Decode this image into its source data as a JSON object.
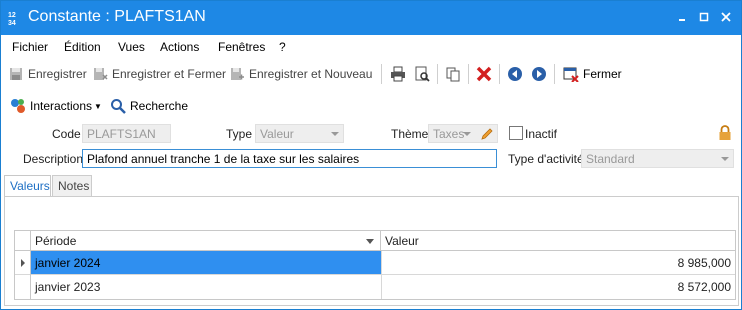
{
  "window": {
    "title": "Constante : PLAFTS1AN",
    "app_icon_text": "1 2\n3 4"
  },
  "menu": [
    "Fichier",
    "Édition",
    "Vues",
    "Actions",
    "Fenêtres",
    "?"
  ],
  "toolbar": {
    "save_label": "Enregistrer",
    "save_close_label": "Enregistrer et Fermer",
    "save_new_label": "Enregistrer et Nouveau",
    "close_label": "Fermer"
  },
  "toolbar2": {
    "interactions_label": "Interactions",
    "search_label": "Recherche"
  },
  "form": {
    "code_label": "Code",
    "code_value": "PLAFTS1AN",
    "type_label": "Type",
    "type_value": "Valeur",
    "theme_label": "Thème",
    "theme_value": "Taxes",
    "inactive_label": "Inactif",
    "description_label": "Description",
    "description_value": "Plafond annuel tranche 1 de la taxe sur les salaires",
    "activity_label": "Type d'activité",
    "activity_value": "Standard"
  },
  "tabs": [
    "Valeurs",
    "Notes"
  ],
  "grid": {
    "columns": [
      "Période",
      "Valeur"
    ],
    "rows": [
      {
        "period": "janvier 2024",
        "value": "8 985,000"
      },
      {
        "period": "janvier 2023",
        "value": "8 572,000"
      }
    ]
  },
  "colors": {
    "titlebar": "#1e88e5",
    "selected_row": "#2f8ff0",
    "accent": "#1e6fc4"
  }
}
